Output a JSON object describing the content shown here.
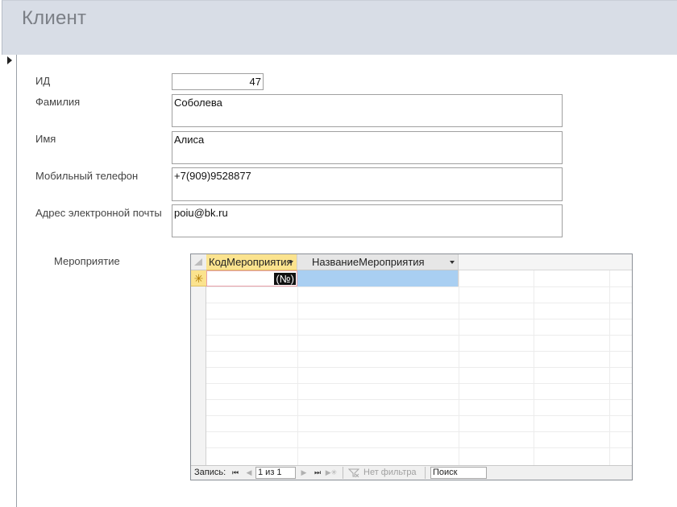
{
  "form": {
    "title": "Клиент"
  },
  "fields": {
    "id": {
      "label": "ИД",
      "value": "47"
    },
    "surname": {
      "label": "Фамилия",
      "value": "Соболева"
    },
    "name": {
      "label": "Имя",
      "value": "Алиса"
    },
    "phone": {
      "label": "Мобильный телефон",
      "value": "+7(909)9528877"
    },
    "email": {
      "label": "Адрес электронной почты",
      "value": "poiu@bk.ru"
    }
  },
  "subform": {
    "label": "Мероприятие",
    "columns": [
      "КодМероприятия",
      "НазваниеМероприятия"
    ],
    "new_row_marker": "✳",
    "new_row_autonumber": "(№)"
  },
  "navigation": {
    "record_label": "Запись:",
    "position": "1 из 1",
    "filter_label": "Нет фильтра",
    "search_placeholder": "Поиск",
    "buttons": {
      "first": "⏮",
      "prev": "◀",
      "next": "▶",
      "last": "⏭",
      "new": "▶✳"
    }
  },
  "icons": {
    "record_selector": "triangle-right-icon",
    "dropdown": "chevron-down-icon",
    "filter": "funnel-icon"
  },
  "colors": {
    "header_bg": "#d8dde6",
    "active_column": "#fbe38e",
    "selected_cell": "#a9cff2"
  }
}
